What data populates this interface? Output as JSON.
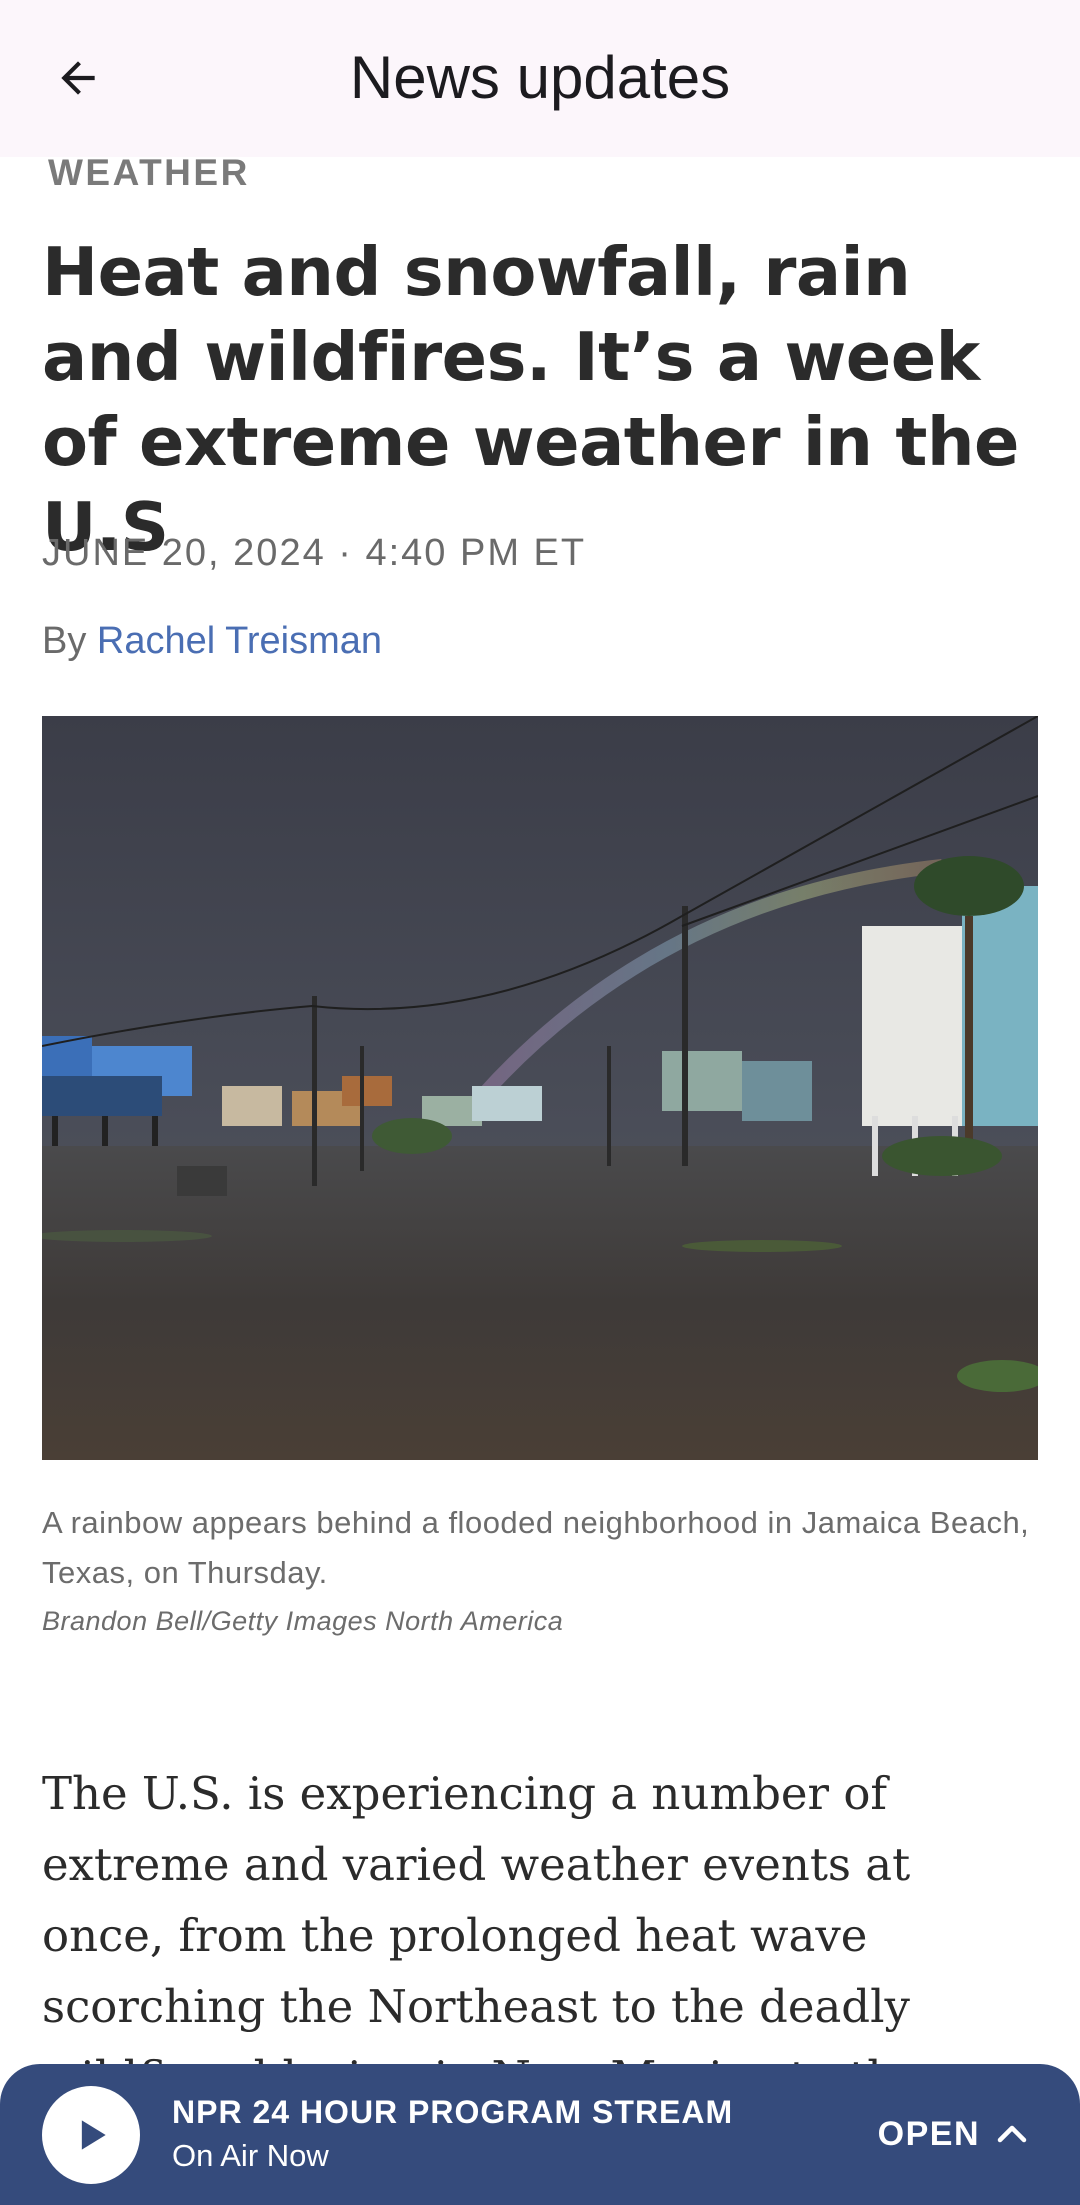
{
  "app_bar": {
    "title": "News updates",
    "back_icon": "arrow-left-icon"
  },
  "article": {
    "section": "WEATHER",
    "headline": "Heat and snowfall, rain and wildfires. It’s a week of extreme weather in the U.S",
    "dateline": "JUNE 20, 2024 · 4:40 PM ET",
    "byline_prefix": "By",
    "author": "Rachel Treisman",
    "caption": "A rainbow appears behind a flooded neighborhood in Jamaica Beach, Texas, on Thursday.",
    "credit": "Brandon Bell/Getty Images North America",
    "body": "The U.S. is experiencing a number of extreme and varied weather events at once, from the prolonged heat wave scorching the Northeast to the deadly wildfires blazing in New Mexico to the tropical storm threatening"
  },
  "player": {
    "title": "NPR 24 HOUR PROGRAM STREAM",
    "subtitle": "On Air Now",
    "open_label": "OPEN",
    "play_icon": "play-icon",
    "chevron_icon": "chevron-up-icon"
  },
  "colors": {
    "app_bar_bg": "#fcf6fb",
    "link": "#4a6eb3",
    "player_bg": "#354b7c"
  }
}
